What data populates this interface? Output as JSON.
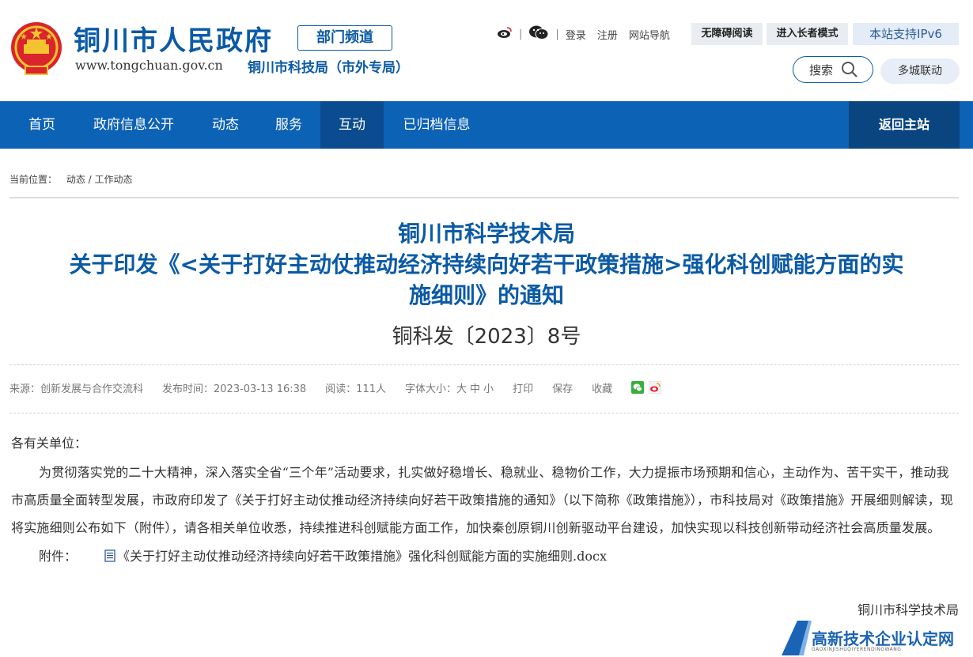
{
  "header": {
    "site_title": "铜川市人民政府",
    "dept_badge": "部门频道",
    "site_url": "www.tongchuan.gov.cn",
    "site_sub": "铜川市科技局（市外专局）",
    "sep": "|",
    "links": {
      "login": "登录",
      "register": "注册",
      "site_nav": "网站导航"
    },
    "accessibility_label": "无障碍阅读",
    "elder_mode_label": "进入长者模式",
    "ipv6_label": "本站支持IPv6",
    "search_label": "搜索",
    "city_link_label": "多城联动"
  },
  "nav": {
    "items": [
      "首页",
      "政府信息公开",
      "动态",
      "服务",
      "互动",
      "已归档信息"
    ],
    "active_index": 4,
    "back_label": "返回主站"
  },
  "breadcrumb": {
    "label": "当前位置：",
    "path": "动态 / 工作动态"
  },
  "article": {
    "title_line1": "铜川市科学技术局",
    "title_line2": "关于印发《<关于打好主动仗推动经济持续向好若干政策措施>强化科创赋能方面的实",
    "title_line3": "施细则》的通知",
    "doc_no": "铜科发〔2023〕8号",
    "meta": {
      "source": "来源：创新发展与合作交流科",
      "publish_time": "发布时间：2023-03-13 16:38",
      "reads": "阅读：111人",
      "font_size_label": "字体大小：",
      "size_large": "大",
      "size_medium": "中",
      "size_small": "小",
      "print": "打印",
      "save": "保存",
      "favorite": "收藏"
    },
    "greeting": "各有关单位：",
    "body": "为贯彻落实党的二十大精神，深入落实全省“三个年”活动要求，扎实做好稳增长、稳就业、稳物价工作，大力提振市场预期和信心，主动作为、苦干实干，推动我市高质量全面转型发展，市政府印发了《关于打好主动仗推动经济持续向好若干政策措施的通知》（以下简称《政策措施》），市科技局对《政策措施》开展细则解读，现将实施细则公布如下（附件），请各相关单位收悉，持续推进科创赋能方面工作，加快秦创原铜川创新驱动平台建设，加快实现以科技创新带动经济社会高质量发展。",
    "attachment_label": "附件：",
    "attachment_file": "《关于打好主动仗推动经济持续向好若干政策措施》强化科创赋能方面的实施细则.docx",
    "signoff": "铜川市科学技术局"
  },
  "watermark": {
    "text": "高新技术企业认定网",
    "sub": "GAOXINJISHUQIYERENDINGWANG"
  },
  "colors": {
    "brand_blue": "#0b5aa6",
    "nav_blue": "#0c62b5",
    "nav_active": "#0a4c8f"
  }
}
